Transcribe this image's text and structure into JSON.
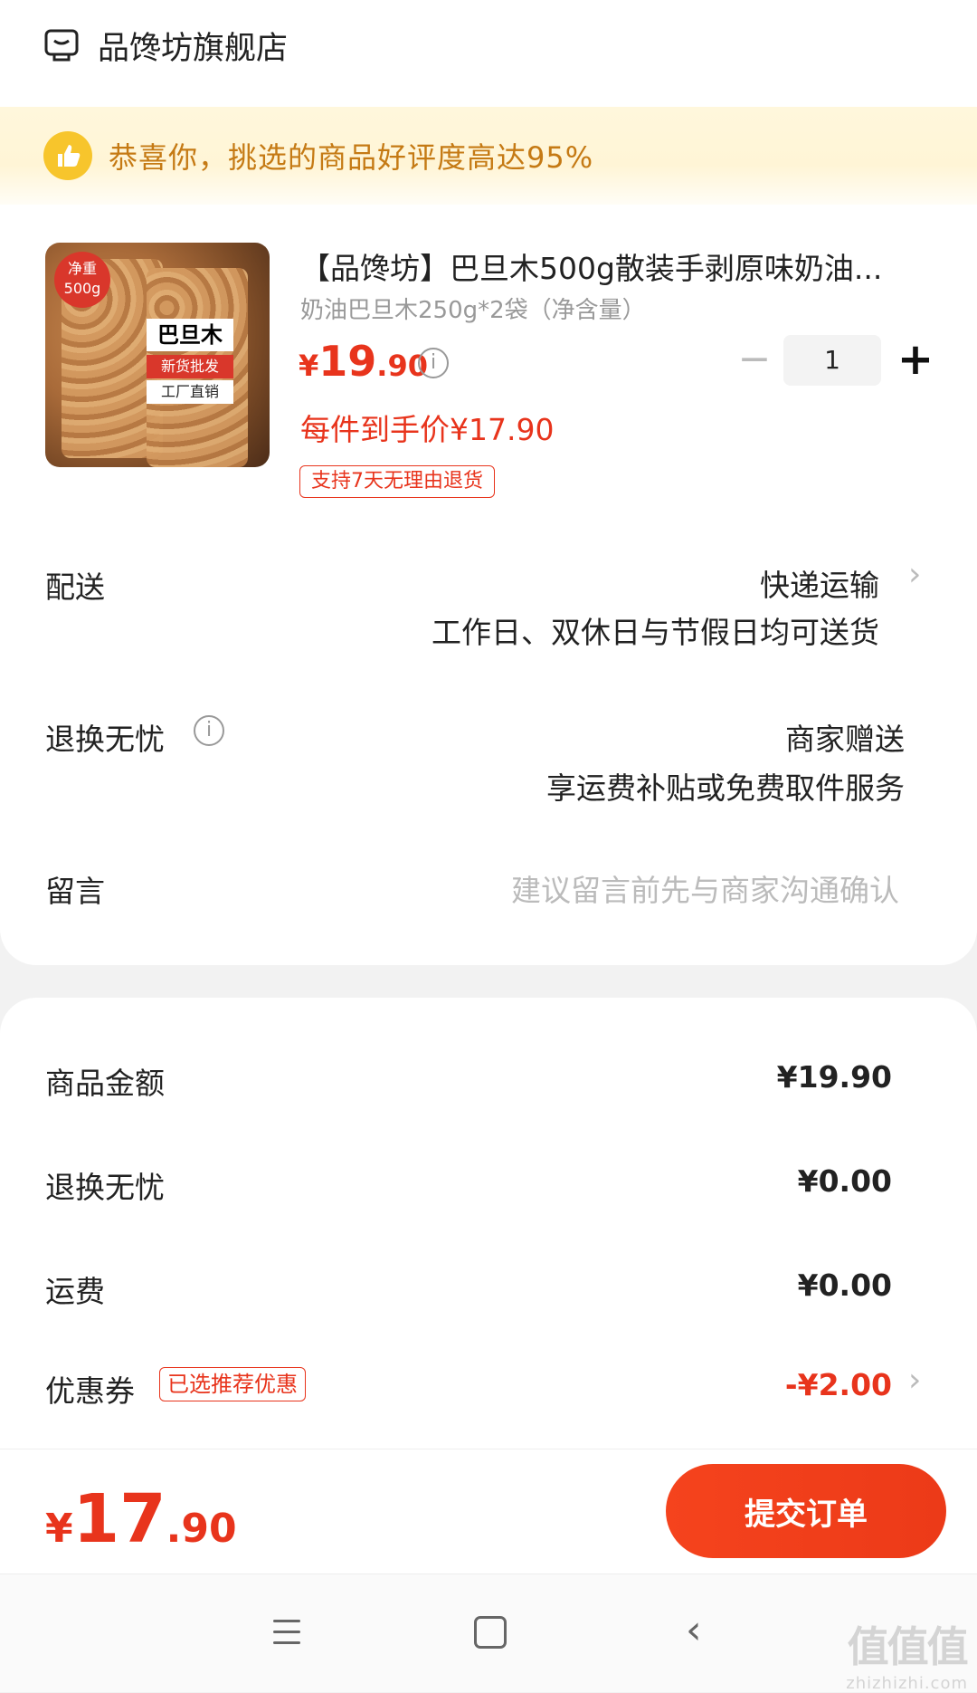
{
  "store": {
    "name": "品馋坊旗舰店",
    "icon": "store-icon"
  },
  "banner": {
    "text": "恭喜你，挑选的商品好评度高达95%",
    "icon": "thumbs-up-icon"
  },
  "product": {
    "image_labels": {
      "net_weight": "净重",
      "net_weight_value": "500g",
      "title": "巴旦木",
      "tag1": "新货批发",
      "tag2": "工厂直销"
    },
    "title": "【品馋坊】巴旦木500g散装手剥原味奶油...",
    "spec": "奶油巴旦木250g*2袋（净含量）",
    "price": {
      "currency": "¥",
      "integer": "19",
      "decimal": ".90"
    },
    "final_price": "每件到手价¥17.90",
    "return_badge": "支持7天无理由退货",
    "quantity": "1"
  },
  "delivery": {
    "label": "配送",
    "method": "快递运输",
    "note": "工作日、双休日与节假日均可送货"
  },
  "worry_free": {
    "label": "退换无忧",
    "value": "商家赠送",
    "note": "享运费补贴或免费取件服务"
  },
  "message": {
    "label": "留言",
    "placeholder": "建议留言前先与商家沟通确认"
  },
  "summary": {
    "items": [
      {
        "label": "商品金额",
        "value": "¥19.90"
      },
      {
        "label": "退换无忧",
        "value": "¥0.00"
      },
      {
        "label": "运费",
        "value": "¥0.00"
      },
      {
        "label": "优惠券",
        "badge": "已选推荐优惠",
        "value": "-¥2.00"
      }
    ]
  },
  "footer": {
    "total": {
      "currency": "¥",
      "integer": "17",
      "decimal": ".90"
    },
    "submit_label": "提交订单"
  },
  "watermark": {
    "big": "值值值",
    "small": "zhizhizhi.com"
  },
  "colors": {
    "accent": "#e8341c",
    "banner_text": "#c57a14",
    "banner_icon": "#f7c52c"
  }
}
